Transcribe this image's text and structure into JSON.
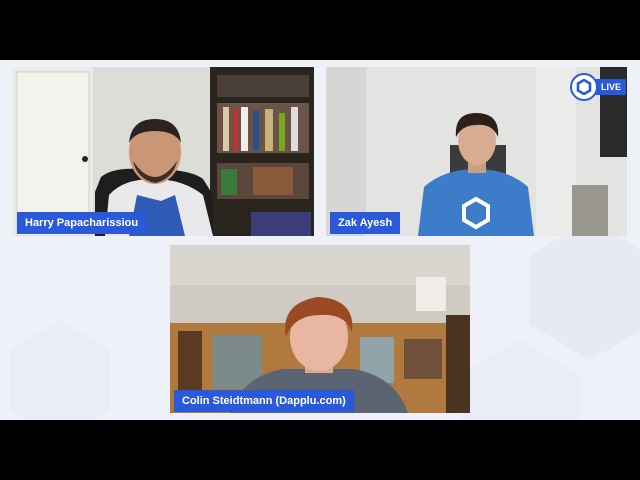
{
  "stream": {
    "live_label": "LIVE",
    "logo_icon": "chainlink-hexagon-icon",
    "accent_color": "#2a5ada"
  },
  "participants": [
    {
      "name": "Harry Papacharissiou"
    },
    {
      "name": "Zak Ayesh"
    },
    {
      "name": "Colin Steidtmann (Dapplu.com)"
    }
  ]
}
